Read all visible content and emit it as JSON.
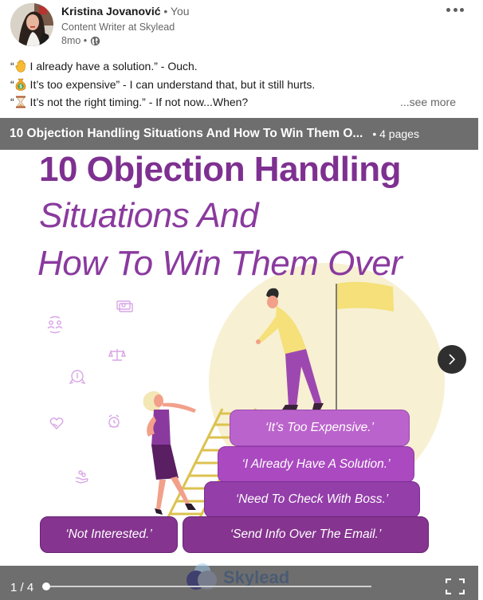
{
  "post": {
    "author_name": "Kristina Jovanović",
    "author_relation": " • You",
    "author_headline": "Content Writer at Skylead",
    "posted_ago": "8mo •",
    "visibility_icon": "globe-icon",
    "more_icon": "ellipsis-icon",
    "text_lines": [
      {
        "open_quote": "“",
        "emoji": "raised-hand-emoji",
        "text": " I already have a solution.” - Ouch."
      },
      {
        "open_quote": "“",
        "emoji": "money-bag-emoji",
        "text": " It’s too expensive” - I can understand that, but it still hurts."
      },
      {
        "open_quote": "“",
        "emoji": "hourglass-emoji",
        "text": " It’s not the right timing.” - If not now...When?"
      }
    ],
    "see_more_label": "...see more"
  },
  "document": {
    "title": "10 Objection Handling Situations And How To Win Them O...",
    "pages_label": "• 4 pages",
    "current_page_label": "1 / 4",
    "progress_fraction": 0.25
  },
  "slide": {
    "heading_bold": "10 Objection Handling",
    "heading_line2": "Situations And",
    "heading_line3": "How To Win Them Over",
    "steps": [
      "‘It’s Too Expensive.’",
      "‘I Already Have A Solution.’",
      "‘Need To Check With Boss.’",
      "‘Send Info Over The Email.’",
      "‘Not Interested.’"
    ],
    "brand_watermark": "Skylead",
    "colors": {
      "heading": "#7e3091",
      "accent_yellow": "#f5e079",
      "sun": "#f7f0d2"
    }
  },
  "controls": {
    "next_icon": "chevron-right-icon",
    "fullscreen_icon": "fullscreen-icon"
  }
}
